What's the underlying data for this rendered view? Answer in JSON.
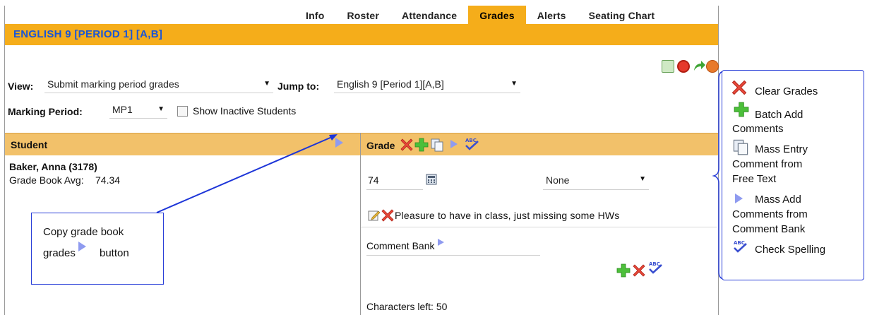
{
  "tabs": [
    {
      "label": "Info",
      "active": false
    },
    {
      "label": "Roster",
      "active": false
    },
    {
      "label": "Attendance",
      "active": false
    },
    {
      "label": "Grades",
      "active": true
    },
    {
      "label": "Alerts",
      "active": false
    },
    {
      "label": "Seating Chart",
      "active": false
    }
  ],
  "header": {
    "course_title": "ENGLISH 9 [PERIOD 1] [A,B]"
  },
  "toolbar_icons": [
    "spreadsheet-icon",
    "cancel-icon",
    "forward-arrow-icon",
    "help-icon"
  ],
  "filters": {
    "view_label": "View:",
    "view_value": "Submit marking period grades",
    "jump_label": "Jump to:",
    "jump_value": "English 9 [Period 1][A,B]",
    "mp_label": "Marking Period:",
    "mp_value": "MP1",
    "show_inactive_label": "Show Inactive Students",
    "show_inactive_checked": false
  },
  "columns": {
    "student": "Student",
    "grade": "Grade"
  },
  "student": {
    "name": "Baker, Anna (3178)",
    "avg_label": "Grade Book Avg:",
    "avg_value": "74.34",
    "grade_value": "74",
    "grade_option": "None",
    "comment": "Pleasure to have in class, just missing some HWs",
    "comment_bank_label": "Comment Bank",
    "chars_left": "Characters left: 50"
  },
  "callout": {
    "line1": "Copy grade book",
    "line2_prefix": "grades",
    "line2_suffix": "button"
  },
  "legend": {
    "clear": "Clear Grades",
    "batch_1": "Batch Add",
    "batch_2": "Comments",
    "mass_entry_1": "Mass Entry",
    "mass_entry_2": "Comment from",
    "mass_entry_3": "Free Text",
    "mass_add_1": "Mass Add",
    "mass_add_2": "Comments from",
    "mass_add_3": "Comment Bank",
    "spell": "Check Spelling"
  },
  "colors": {
    "header": "#f5ad1a",
    "column_header": "#f2c16a",
    "title": "#1a55d6",
    "annotation": "#2a3fd8"
  }
}
